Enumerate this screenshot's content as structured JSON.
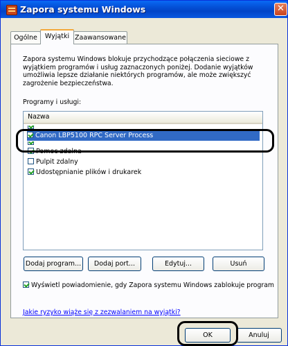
{
  "window": {
    "title": "Zapora systemu Windows",
    "close_glyph": "✕"
  },
  "tabs": [
    {
      "label": "Ogólne"
    },
    {
      "label": "Wyjątki"
    },
    {
      "label": "Zaawansowane"
    }
  ],
  "description": "Zapora systemu Windows blokuje przychodzące połączenia sieciowe z wyjątkiem programów i usług zaznaczonych poniżej. Dodanie wyjątków umożliwia lepsze działanie niektórych programów, ale może zwiększyć zagrożenie bezpieczeństwa.",
  "programs_label": "Programy i usługi:",
  "list": {
    "header": "Nazwa",
    "items": [
      {
        "label": "Canon LBP5100 RPC Server Process",
        "checked": true
      },
      {
        "label": "Pomoc zdalna",
        "checked": true
      },
      {
        "label": "Pulpit zdalny",
        "checked": false
      },
      {
        "label": "Udostępnianie plików i drukarek",
        "checked": true
      }
    ]
  },
  "buttons": {
    "add_program": "Dodaj program...",
    "add_port": "Dodaj port...",
    "edit": "Edytuj...",
    "delete": "Usuń",
    "ok": "OK",
    "cancel": "Anuluj"
  },
  "notify": {
    "label": "Wyświetl powiadomienie, gdy Zapora systemu Windows zablokuje program",
    "checked": true
  },
  "risk_link": "Jakie ryzyko wiąże się z zezwalaniem na wyjątki?"
}
